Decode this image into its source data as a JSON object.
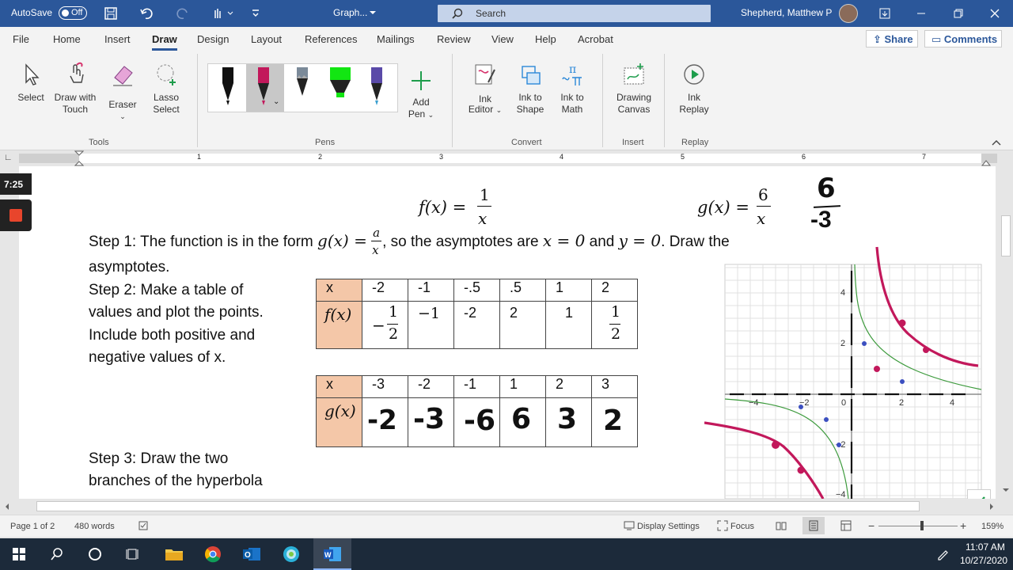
{
  "titlebar": {
    "autosave_label": "AutoSave",
    "autosave_state": "Off",
    "doc_title": "Graph...",
    "search_placeholder": "Search",
    "user_name": "Shepherd, Matthew P"
  },
  "menu": {
    "tabs": [
      "File",
      "Home",
      "Insert",
      "Draw",
      "Design",
      "Layout",
      "References",
      "Mailings",
      "Review",
      "View",
      "Help",
      "Acrobat"
    ],
    "active": "Draw",
    "share": "Share",
    "comments": "Comments"
  },
  "ribbon": {
    "tools": {
      "select": "Select",
      "draw_touch_1": "Draw with",
      "draw_touch_2": "Touch",
      "eraser": "Eraser",
      "lasso_1": "Lasso",
      "lasso_2": "Select",
      "group": "Tools"
    },
    "pens": {
      "add_pen_1": "Add",
      "add_pen_2": "Pen",
      "group": "Pens"
    },
    "convert": {
      "ink_editor_1": "Ink",
      "ink_editor_2": "Editor",
      "ink_shape_1": "Ink to",
      "ink_shape_2": "Shape",
      "ink_math_1": "Ink to",
      "ink_math_2": "Math",
      "group": "Convert"
    },
    "insert": {
      "canvas_1": "Drawing",
      "canvas_2": "Canvas",
      "group": "Insert"
    },
    "replay": {
      "replay_1": "Ink",
      "replay_2": "Replay",
      "group": "Replay"
    }
  },
  "ruler": {
    "numbers": [
      "1",
      "2",
      "3",
      "4",
      "5",
      "6",
      "7"
    ]
  },
  "recorder": {
    "time": "7:25"
  },
  "doc": {
    "f_def_lhs": "f(x) =",
    "f_num": "1",
    "f_den": "x",
    "g_def_lhs": "g(x) =",
    "g_num": "6",
    "g_den": "x",
    "step1_a": "Step 1:  The function is in the form ",
    "step1_g": "g(x) =",
    "step1_frac_num": "a",
    "step1_frac_den": "x",
    "step1_b": ", so the asymptotes are ",
    "step1_x0": "x = 0",
    "step1_and": " and ",
    "step1_y0": "y = 0",
    "step1_c": ".  Draw the",
    "step1_line2": "asymptotes.",
    "step2_lines": [
      "Step 2:  Make a table of",
      "values and plot the points.",
      "Include both positive and",
      "negative values of x."
    ],
    "step3_lines": [
      "Step 3:  Draw the two",
      "branches of the hyperbola"
    ],
    "table_f": {
      "head": "x",
      "row_label": "f(x)",
      "x": [
        "-2",
        "-1",
        "-.5",
        ".5",
        "1",
        "2"
      ],
      "neg_half_sign": "−",
      "half_num": "1",
      "half_den": "2",
      "neg_one": "−1",
      "cells": [
        "-2",
        "2",
        "1"
      ]
    },
    "table_g": {
      "head": "x",
      "row_label": "g(x)",
      "x": [
        "-3",
        "-2",
        "-1",
        "1",
        "2",
        "3"
      ],
      "handwritten": [
        "-2",
        "-3",
        "-6",
        "6",
        "3",
        "2"
      ]
    },
    "handwritten_frac_num": "6",
    "handwritten_frac_den": "-3"
  },
  "graph": {
    "x_ticks": [
      "−4",
      "−2",
      "0",
      "2",
      "4"
    ],
    "y_ticks": [
      "4",
      "2",
      "−2",
      "−4"
    ]
  },
  "status": {
    "page": "Page 1 of 2",
    "words": "480 words",
    "display_settings": "Display Settings",
    "focus": "Focus",
    "zoom": "159%"
  },
  "taskbar": {
    "time": "11:07 AM",
    "date": "10/27/2020"
  }
}
